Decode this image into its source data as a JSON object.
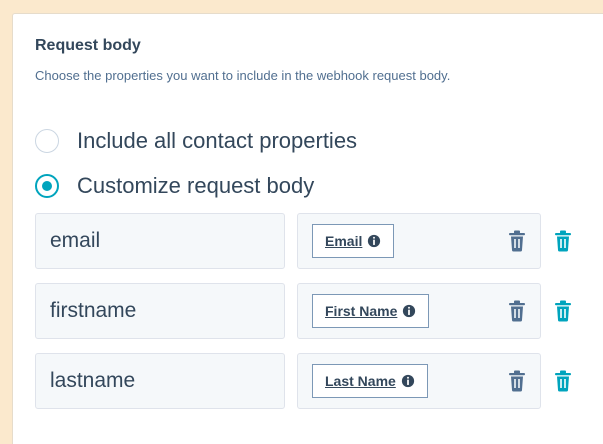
{
  "section": {
    "title": "Request body",
    "help_text": "Choose the properties you want to include in the webhook request body."
  },
  "radio_options": [
    {
      "label": "Include all contact properties",
      "selected": false
    },
    {
      "label": "Customize request body",
      "selected": true
    }
  ],
  "properties": [
    {
      "key": "email",
      "token": "Email"
    },
    {
      "key": "firstname",
      "token": "First Name"
    },
    {
      "key": "lastname",
      "token": "Last Name"
    }
  ],
  "colors": {
    "accent": "#00a4bd",
    "text": "#33475b",
    "background": "#fbe9cd"
  },
  "icons": {
    "token_info": "info-circle-icon",
    "delete_token": "trash-icon",
    "delete_row": "trash-icon"
  }
}
